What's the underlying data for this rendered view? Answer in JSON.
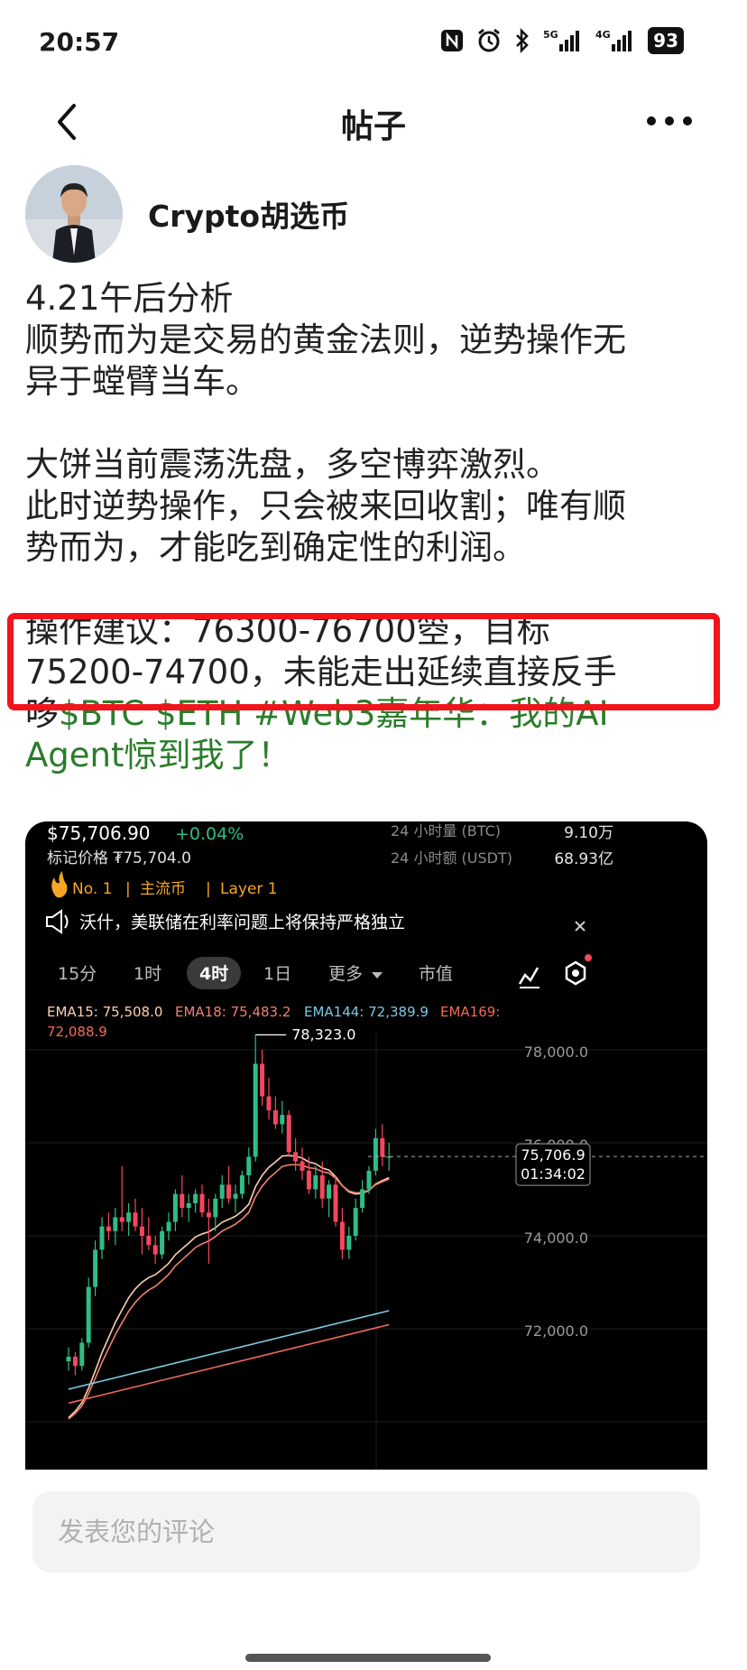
{
  "status_bar": {
    "time": "20:57",
    "network1": "5G",
    "network2": "4G",
    "battery": "93"
  },
  "header": {
    "title": "帖子"
  },
  "author": {
    "name": "Crypto胡选币"
  },
  "post": {
    "line1": "4.21午后分析",
    "line2": "顺势而为是交易的黄金法则，逆势操作无",
    "line3": "异于螳臂当车。",
    "line4": "大饼当前震荡洗盘，多空博弈激烈。",
    "line5": "此时逆势操作，只会被来回收割；唯有顺",
    "line6": "势而为，才能吃到确定性的利润。",
    "line7": "操作建议：76300-76700箜，目标",
    "line8": "75200-74700，未能走出延续直接反手",
    "line9_prefix": "哆",
    "line9_tags": "$BTC $ETH #Web3嘉年华：我的AI",
    "line10_tags": "Agent惊到我了！"
  },
  "chart_card": {
    "price": "$75,706.90",
    "change": "+0.04%",
    "mark_price": "标记价格 ₮75,704.0",
    "badges": [
      "No. 1",
      "主流币",
      "Layer 1"
    ],
    "vol_btc_label": "24 小时量 (BTC)",
    "vol_btc_value": "9.10万",
    "vol_usdt_label": "24 小时额 (USDT)",
    "vol_usdt_value": "68.93亿",
    "news": "沃什，美联储在利率问题上将保持严格独立",
    "tabs": [
      "15分",
      "1时",
      "4时",
      "1日",
      "更多",
      "市值"
    ],
    "active_tab": "4时",
    "ema": {
      "ema15": "EMA15: 75,508.0",
      "ema18": "EMA18: 75,483.2",
      "ema144": "EMA144: 72,389.9",
      "ema169_label": "EMA169:",
      "ema169_value": "72,088.9"
    },
    "high_label": "78,323.0",
    "y_ticks": [
      "78,000.0",
      "76,000.0",
      "74,000.0",
      "72,000.0"
    ],
    "current_price": "75,706.9",
    "countdown": "01:34:02",
    "colors": {
      "up": "#2ebd85",
      "down": "#f6465d",
      "ema15": "#ffd0b0",
      "ema18": "#f08070",
      "ema144": "#7ec8e3",
      "ema169": "#f06a5a"
    }
  },
  "chart_data": {
    "type": "candlestick",
    "y_axis_ticks": [
      78000,
      76000,
      74000,
      72000
    ],
    "high_marker": 78323.0,
    "last_price": 75706.9,
    "candles": [
      [
        71300,
        71600,
        71100,
        71400
      ],
      [
        71400,
        71500,
        71000,
        71200
      ],
      [
        71200,
        71800,
        71100,
        71700
      ],
      [
        71700,
        73100,
        71600,
        72900
      ],
      [
        72900,
        73900,
        72700,
        73700
      ],
      [
        73700,
        74400,
        73500,
        74200
      ],
      [
        74200,
        74500,
        73900,
        74100
      ],
      [
        74100,
        74600,
        73800,
        74400
      ],
      [
        74400,
        75500,
        74100,
        74300
      ],
      [
        74300,
        74700,
        74000,
        74500
      ],
      [
        74500,
        74800,
        74100,
        74200
      ],
      [
        74200,
        74600,
        73600,
        74000
      ],
      [
        74000,
        74400,
        73700,
        73800
      ],
      [
        73800,
        74000,
        73400,
        73600
      ],
      [
        73600,
        74200,
        73500,
        74100
      ],
      [
        74100,
        74500,
        73900,
        74300
      ],
      [
        74300,
        75000,
        74100,
        74900
      ],
      [
        74900,
        75300,
        74400,
        74600
      ],
      [
        74600,
        74900,
        74300,
        74700
      ],
      [
        74700,
        75000,
        74500,
        74900
      ],
      [
        74900,
        75100,
        74400,
        74500
      ],
      [
        74500,
        74800,
        73400,
        74400
      ],
      [
        74400,
        74900,
        74100,
        74800
      ],
      [
        74800,
        75300,
        74600,
        75100
      ],
      [
        75100,
        75500,
        74700,
        74800
      ],
      [
        74800,
        75100,
        74500,
        74900
      ],
      [
        74900,
        75400,
        74800,
        75300
      ],
      [
        75300,
        75900,
        75100,
        75700
      ],
      [
        75700,
        78323,
        75600,
        77700
      ],
      [
        77700,
        78000,
        76800,
        77000
      ],
      [
        77000,
        77400,
        76500,
        76700
      ],
      [
        76700,
        77000,
        76300,
        76400
      ],
      [
        76400,
        76900,
        76200,
        76600
      ],
      [
        76600,
        76700,
        75700,
        75800
      ],
      [
        75800,
        76100,
        75400,
        75600
      ],
      [
        75600,
        75900,
        75200,
        75400
      ],
      [
        75400,
        75700,
        74900,
        75000
      ],
      [
        75000,
        75500,
        74800,
        75300
      ],
      [
        75300,
        75600,
        74600,
        74800
      ],
      [
        74800,
        75200,
        74400,
        75100
      ],
      [
        75100,
        75300,
        74200,
        74300
      ],
      [
        74300,
        74600,
        73500,
        73700
      ],
      [
        73700,
        74200,
        73500,
        74000
      ],
      [
        74000,
        74800,
        73900,
        74600
      ],
      [
        74600,
        75200,
        74500,
        75000
      ],
      [
        75000,
        75500,
        74900,
        75400
      ],
      [
        75400,
        76300,
        75300,
        76100
      ],
      [
        76100,
        76400,
        75500,
        75700
      ],
      [
        75700,
        76000,
        75400,
        75706.9
      ]
    ]
  },
  "comment": {
    "placeholder": "发表您的评论"
  }
}
